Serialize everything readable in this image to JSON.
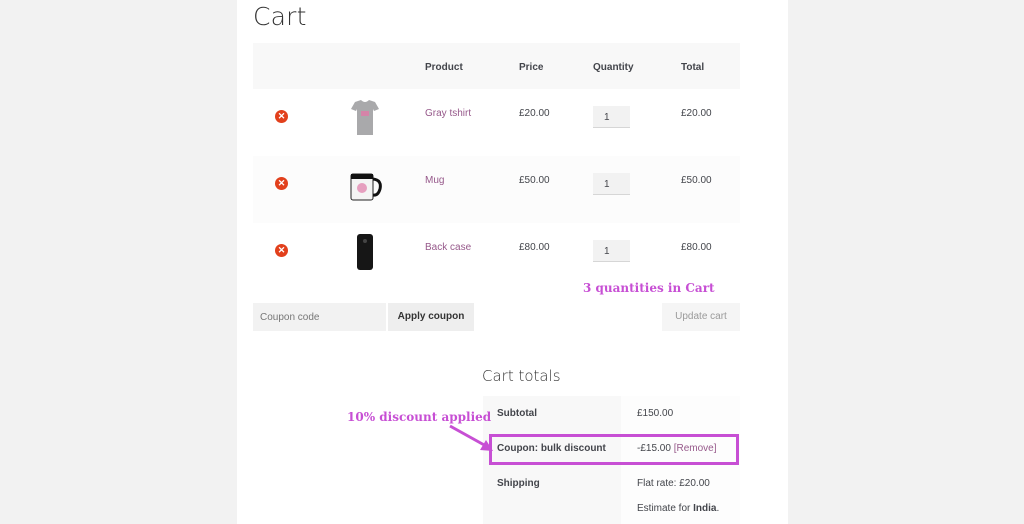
{
  "page": {
    "title": "Cart"
  },
  "cart": {
    "headers": {
      "product": "Product",
      "price": "Price",
      "quantity": "Quantity",
      "total": "Total"
    },
    "items": [
      {
        "name": "Gray tshirt",
        "price": "£20.00",
        "quantity": "1",
        "total": "£20.00",
        "image": "gray-tshirt-thumbnail"
      },
      {
        "name": "Mug",
        "price": "£50.00",
        "quantity": "1",
        "total": "£50.00",
        "image": "mug-thumbnail"
      },
      {
        "name": "Back case",
        "price": "£80.00",
        "quantity": "1",
        "total": "£80.00",
        "image": "phone-case-thumbnail"
      }
    ],
    "remove_icon": "remove-x-icon"
  },
  "coupon": {
    "placeholder": "Coupon code",
    "apply_label": "Apply coupon"
  },
  "update_label": "Update cart",
  "annotations": {
    "quantities": "3 quantities in Cart",
    "discount": "10% discount applied",
    "color": "#c74fd4"
  },
  "totals": {
    "title": "Cart totals",
    "subtotal_label": "Subtotal",
    "subtotal_value": "£150.00",
    "coupon_label": "Coupon: bulk discount",
    "coupon_value": "-£15.00",
    "coupon_remove": "[Remove]",
    "shipping_label": "Shipping",
    "shipping_value": "Flat rate: £20.00",
    "estimate_prefix": "Estimate for ",
    "estimate_country": "India",
    "estimate_suffix": "."
  },
  "colors": {
    "link": "#96588a",
    "remove_icon": "#e2401c"
  }
}
